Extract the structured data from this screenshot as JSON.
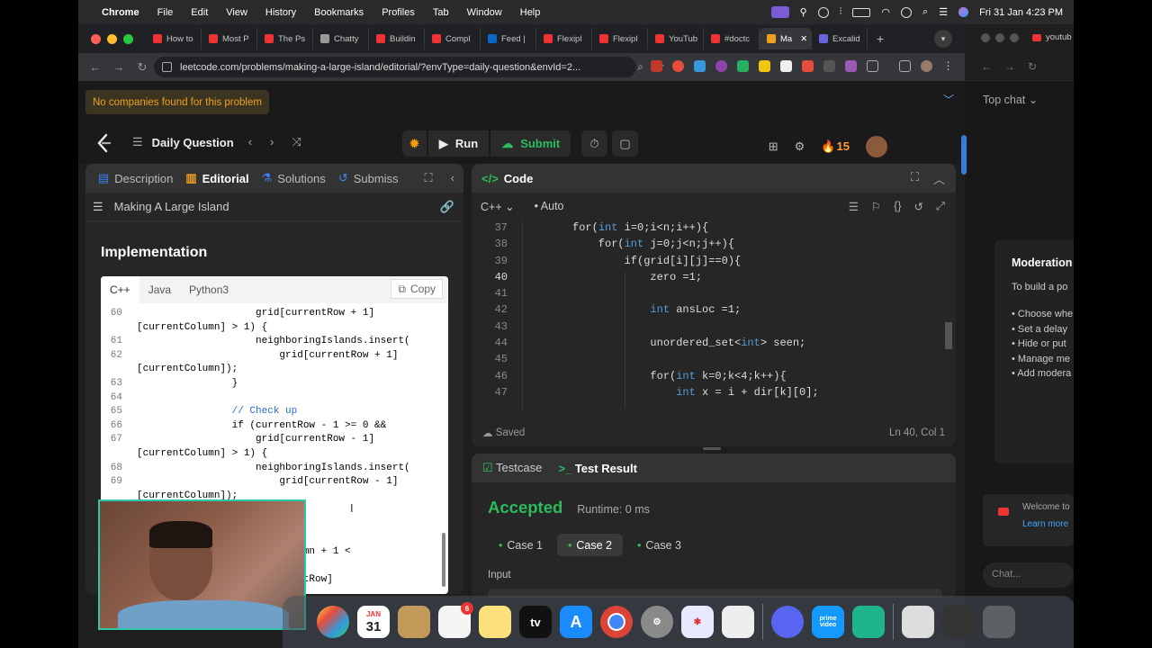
{
  "menubar": {
    "app": "Chrome",
    "items": [
      "File",
      "Edit",
      "View",
      "History",
      "Bookmarks",
      "Profiles",
      "Tab",
      "Window",
      "Help"
    ],
    "datetime": "Fri 31 Jan  4:23 PM"
  },
  "tabs": [
    {
      "label": "How to",
      "color": "#e33"
    },
    {
      "label": "Most P",
      "color": "#e33"
    },
    {
      "label": "The Ps",
      "color": "#e33"
    },
    {
      "label": "Chatty",
      "color": "#999"
    },
    {
      "label": "Buildin",
      "color": "#e33"
    },
    {
      "label": "Compl",
      "color": "#e33"
    },
    {
      "label": "Feed |",
      "color": "#0a66c2"
    },
    {
      "label": "Flexipl",
      "color": "#e33"
    },
    {
      "label": "Flexipl",
      "color": "#e33"
    },
    {
      "label": "YouTub",
      "color": "#e33"
    },
    {
      "label": "#doctc",
      "color": "#e33"
    },
    {
      "label": "Ma",
      "color": "#f0a020"
    },
    {
      "label": "Excalid",
      "color": "#6965db"
    }
  ],
  "address": {
    "url": "leetcode.com/problems/making-a-large-island/editorial/?envType=daily-question&envId=2..."
  },
  "banner": {
    "text": "No companies found for this problem"
  },
  "header": {
    "title": "Daily Question",
    "run_label": "Run",
    "submit_label": "Submit",
    "streak": "15"
  },
  "left": {
    "tabs": [
      "Description",
      "Editorial",
      "Solutions",
      "Submiss"
    ],
    "problem_title": "Making A Large Island",
    "section_title": "Implementation",
    "lang_tabs": [
      "C++",
      "Java",
      "Python3"
    ],
    "copy_label": "Copy",
    "code_lines": [
      {
        "ln": "60",
        "text": "                    grid[currentRow + 1]"
      },
      {
        "ln": "",
        "text": "[currentColumn] > 1) {"
      },
      {
        "ln": "61",
        "text": "                    neighboringIslands.insert("
      },
      {
        "ln": "62",
        "text": "                        grid[currentRow + 1]"
      },
      {
        "ln": "",
        "text": "[currentColumn]);"
      },
      {
        "ln": "63",
        "text": "                }"
      },
      {
        "ln": "64",
        "text": ""
      },
      {
        "ln": "65",
        "text": "                // Check up"
      },
      {
        "ln": "66",
        "text": "                if (currentRow - 1 >= 0 &&"
      },
      {
        "ln": "67",
        "text": "                    grid[currentRow - 1]"
      },
      {
        "ln": "",
        "text": "[currentColumn] > 1) {"
      },
      {
        "ln": "68",
        "text": "                    neighboringIslands.insert("
      },
      {
        "ln": "69",
        "text": "                        grid[currentRow - 1]"
      },
      {
        "ln": "",
        "text": "[currentColumn]);"
      },
      {
        "ln": "",
        "text": ""
      },
      {
        "ln": "",
        "text": ""
      },
      {
        "ln": "",
        "text": "                      right"
      },
      {
        "ln": "",
        "text": "                     entColumn + 1 <"
      },
      {
        "ln": "",
        "text": ""
      },
      {
        "ln": "",
        "text": "                     [currentRow]"
      }
    ]
  },
  "right": {
    "panel_title": "Code",
    "language": "C++",
    "mode": "Auto",
    "editor_lines": [
      {
        "ln": "37",
        "pre": "for(",
        "kw": "int",
        "post": " i=0;i<n;i++){",
        "indent": 0
      },
      {
        "ln": "38",
        "pre": "    for(",
        "kw": "int",
        "post": " j=0;j<n;j++){",
        "indent": 0
      },
      {
        "ln": "39",
        "pre": "        if(grid[i][j]==0){",
        "kw": "",
        "post": "",
        "indent": 0
      },
      {
        "ln": "40",
        "pre": "            zero =1;",
        "kw": "",
        "post": "",
        "indent": 0
      },
      {
        "ln": "41",
        "pre": "",
        "kw": "",
        "post": "",
        "indent": 0
      },
      {
        "ln": "42",
        "pre": "            ",
        "kw": "int",
        "post": " ansLoc =1;",
        "indent": 0
      },
      {
        "ln": "43",
        "pre": "",
        "kw": "",
        "post": "",
        "indent": 0
      },
      {
        "ln": "44",
        "pre": "            unordered_set<",
        "kw": "int",
        "post": "> seen;",
        "indent": 0
      },
      {
        "ln": "45",
        "pre": "",
        "kw": "",
        "post": "",
        "indent": 0
      },
      {
        "ln": "46",
        "pre": "            for(",
        "kw": "int",
        "post": " k=0;k<4;k++){",
        "indent": 0
      },
      {
        "ln": "47",
        "pre": "                ",
        "kw": "int",
        "post": " x = i + dir[k][0];",
        "indent": 0
      }
    ],
    "saved": "Saved",
    "cursor_pos": "Ln 40, Col 1",
    "result_tabs": [
      "Testcase",
      "Test Result"
    ],
    "status": "Accepted",
    "runtime": "Runtime: 0 ms",
    "cases": [
      "Case 1",
      "Case 2",
      "Case 3"
    ],
    "input_label": "Input"
  },
  "chat": {
    "tab_label": "youtub",
    "top_chat": "Top chat",
    "mod_title": "Moderation",
    "mod_sub": "To build a po",
    "mod_items": [
      "• Choose whe",
      "• Set a delay",
      "• Hide or put",
      "• Manage me",
      "• Add modera"
    ],
    "welcome": "Welcome to",
    "learn_more": "Learn more",
    "chat_placeholder": "Chat..."
  },
  "dock": {
    "calendar_month": "JAN",
    "calendar_day": "31",
    "reminders_badge": "6",
    "tv_label": "tv",
    "prime_label": "prime video"
  }
}
